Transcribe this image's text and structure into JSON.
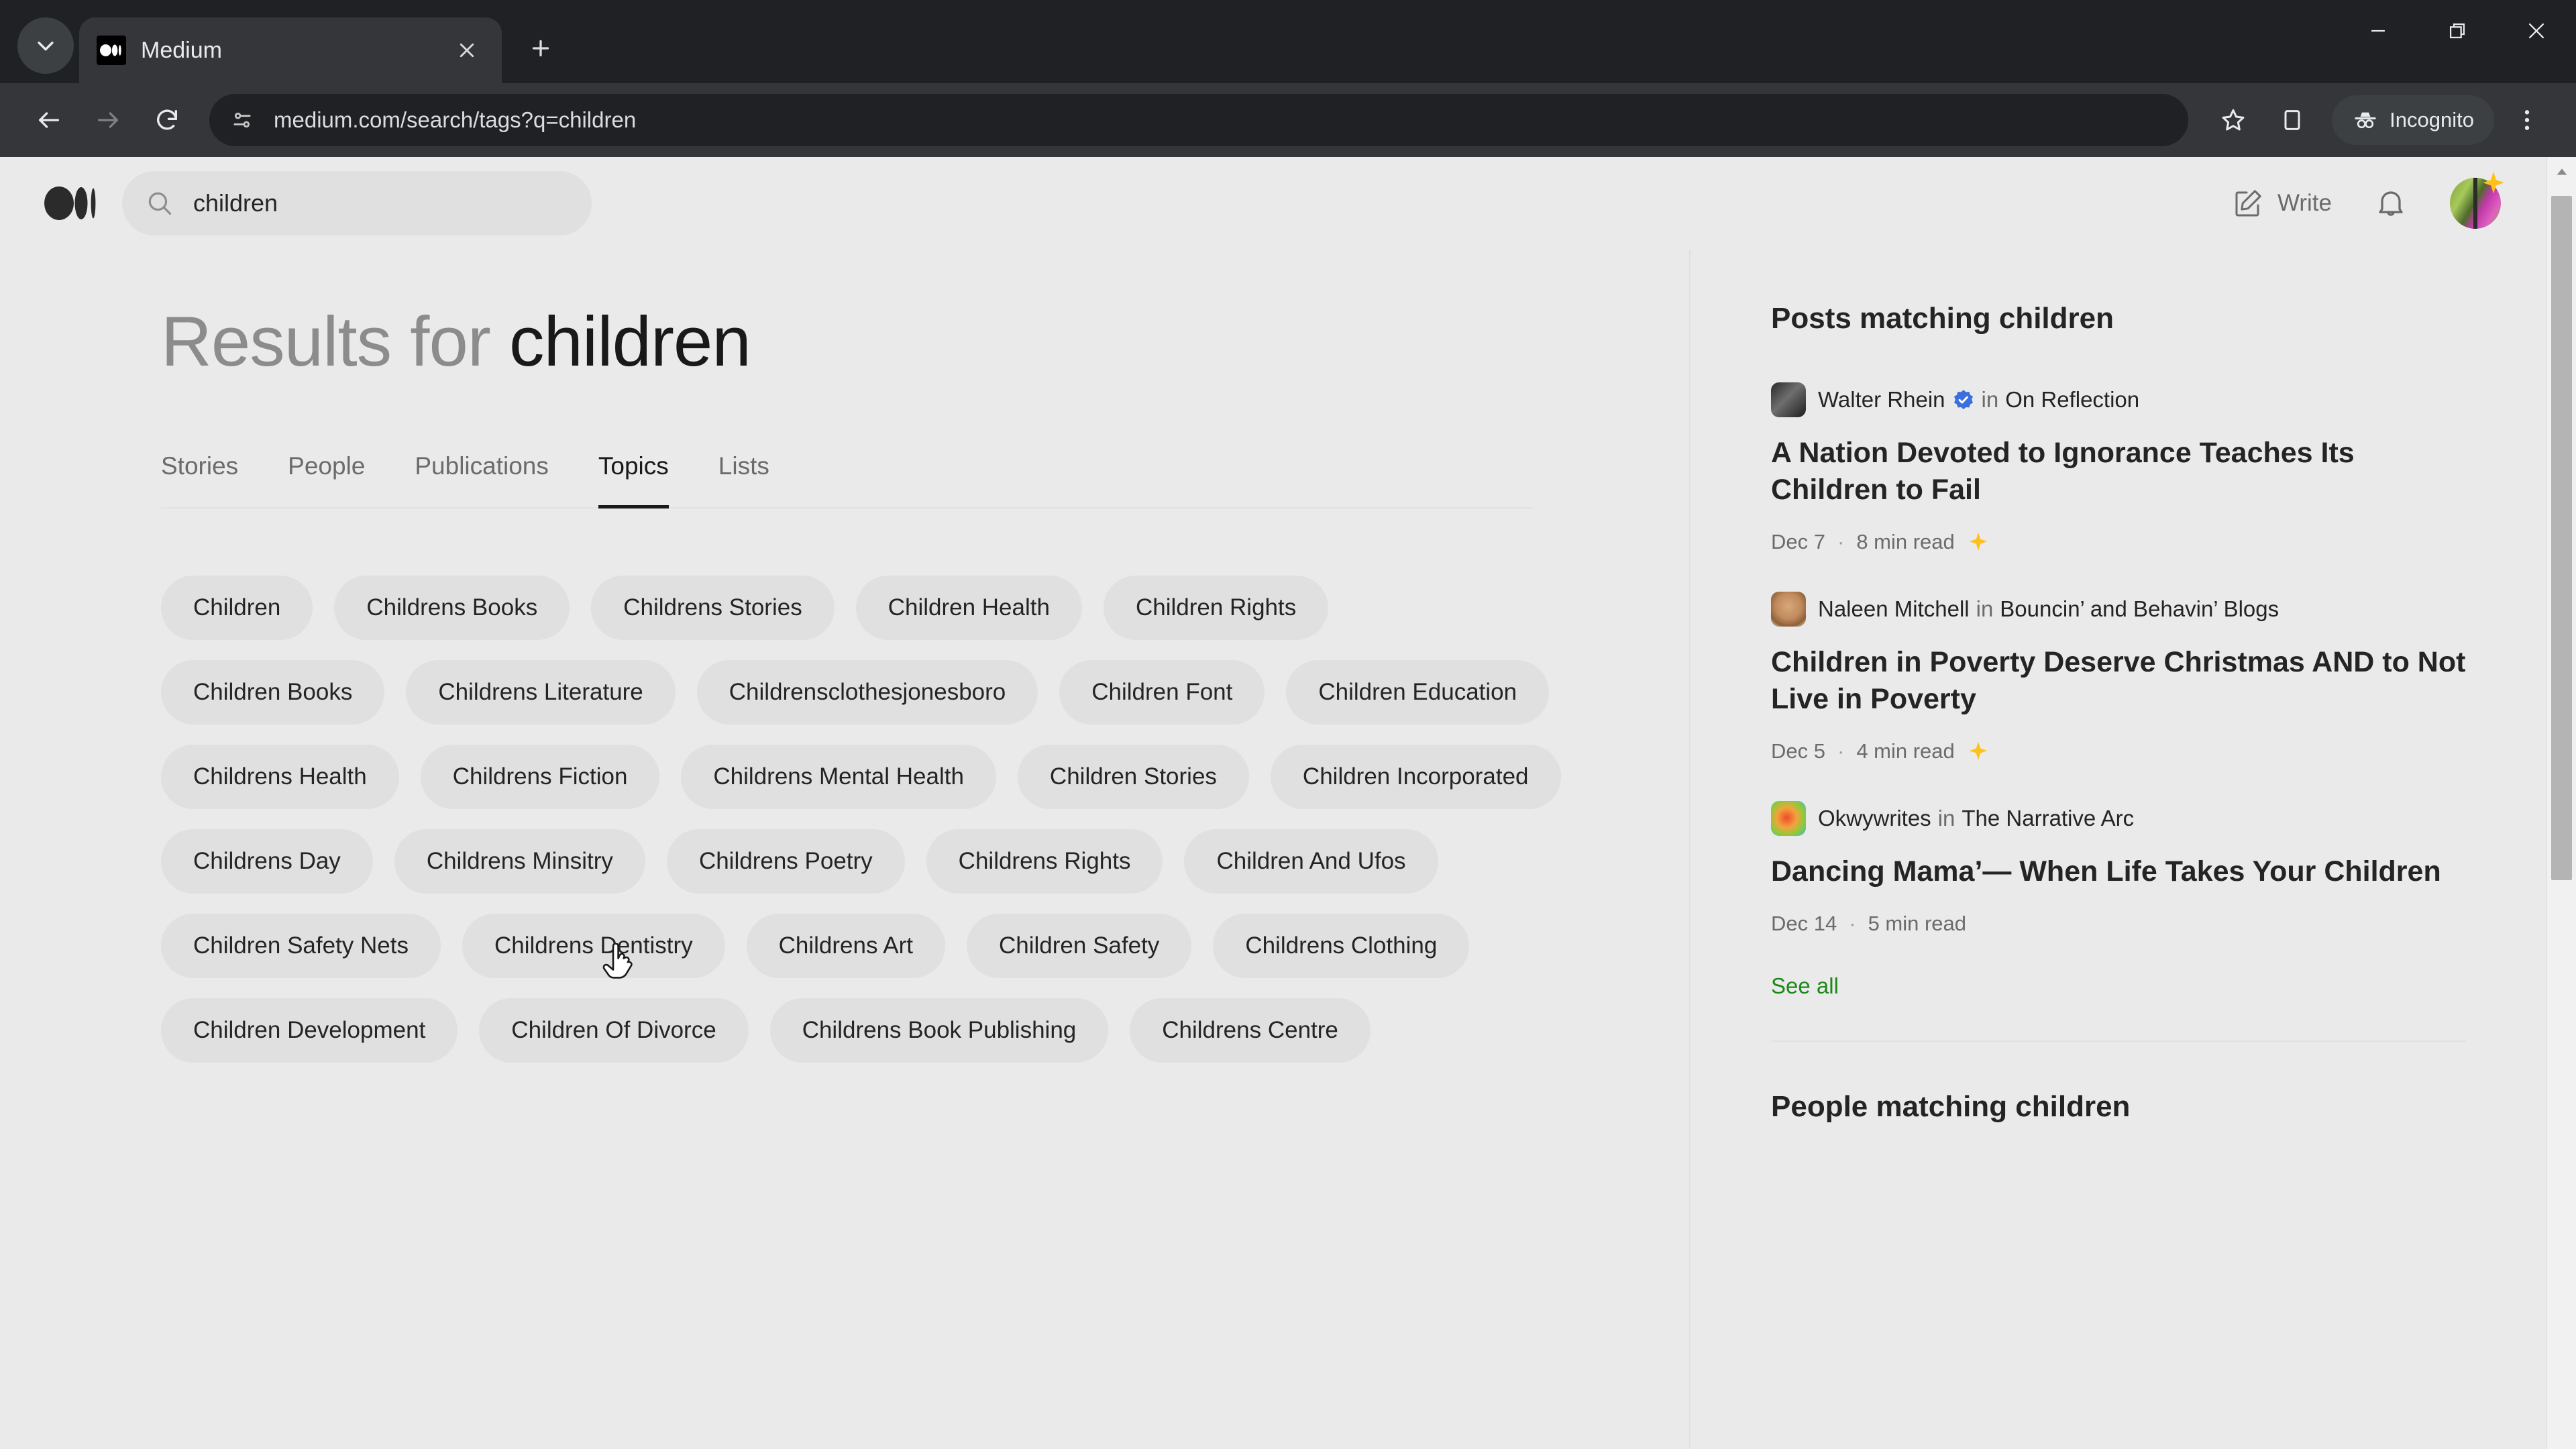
{
  "browser": {
    "tab": {
      "title": "Medium",
      "favicon": "medium-favicon"
    },
    "tab_search_label": "Search tabs",
    "new_tab_label": "New tab",
    "close_tab_label": "Close",
    "nav": {
      "back": "Back",
      "forward": "Forward",
      "reload": "Reload"
    },
    "omnibox": {
      "url": "medium.com/search/tags?q=children",
      "site_info_icon": "page-settings-icon"
    },
    "actions": {
      "bookmark": "Bookmark this tab",
      "side_panel": "Side panel"
    },
    "incognito": {
      "label": "Incognito",
      "icon": "incognito-icon"
    },
    "menu_label": "Customize and control Google Chrome",
    "window": {
      "minimize": "Minimize",
      "restore": "Restore",
      "close": "Close"
    }
  },
  "site_header": {
    "logo": "medium-logo",
    "search": {
      "value": "children",
      "placeholder": "Search",
      "icon": "search-icon"
    },
    "write": {
      "label": "Write",
      "icon": "write-pencil-icon"
    },
    "notifications_icon": "bell-icon",
    "avatar": {
      "name": "user-avatar",
      "badge": "star-badge"
    }
  },
  "main": {
    "title_prefix": "Results for",
    "title_query": "children",
    "tabs": [
      {
        "label": "Stories",
        "active": false
      },
      {
        "label": "People",
        "active": false
      },
      {
        "label": "Publications",
        "active": false
      },
      {
        "label": "Topics",
        "active": true
      },
      {
        "label": "Lists",
        "active": false
      }
    ],
    "topic_chips": [
      "Children",
      "Childrens Books",
      "Childrens Stories",
      "Children Health",
      "Children Rights",
      "Children Books",
      "Childrens Literature",
      "Childrensclothesjonesboro",
      "Children Font",
      "Children Education",
      "Childrens Health",
      "Childrens Fiction",
      "Childrens Mental Health",
      "Children Stories",
      "Children Incorporated",
      "Childrens Day",
      "Childrens Minsitry",
      "Childrens Poetry",
      "Childrens Rights",
      "Children And Ufos",
      "Children Safety Nets",
      "Childrens Dentistry",
      "Childrens Art",
      "Children Safety",
      "Childrens Clothing",
      "Children Development",
      "Children Of Divorce",
      "Childrens Book Publishing",
      "Childrens Centre"
    ]
  },
  "sidebar": {
    "posts_heading": "Posts matching children",
    "posts": [
      {
        "author": "Walter Rhein",
        "verified": true,
        "in_label": "in",
        "publication": "On Reflection",
        "title": "A Nation Devoted to Ignorance Teaches Its Children to Fail",
        "date": "Dec 7",
        "read_time": "8 min read",
        "member_only": true
      },
      {
        "author": "Naleen Mitchell",
        "verified": false,
        "in_label": "in",
        "publication": "Bouncin’ and Behavin’ Blogs",
        "title": "Children in Poverty Deserve Christmas AND to Not Live in Poverty",
        "date": "Dec 5",
        "read_time": "4 min read",
        "member_only": true
      },
      {
        "author": "Okwywrites",
        "verified": false,
        "in_label": "in",
        "publication": "The Narrative Arc",
        "title": "Dancing Mama’— When Life Takes Your Children",
        "date": "Dec 14",
        "read_time": "5 min read",
        "member_only": false
      }
    ],
    "see_all_label": "See all",
    "people_heading": "People matching children"
  },
  "colors": {
    "chrome_bg": "#202124",
    "toolbar_bg": "#35363a",
    "page_bg": "#eaeaea",
    "chip_bg": "#e0e0e0",
    "text_primary": "#242424",
    "text_muted": "#6b6b6b",
    "link_green": "#1a8917",
    "verified_blue": "#3b6fe0",
    "star_yellow": "#ffc017"
  }
}
